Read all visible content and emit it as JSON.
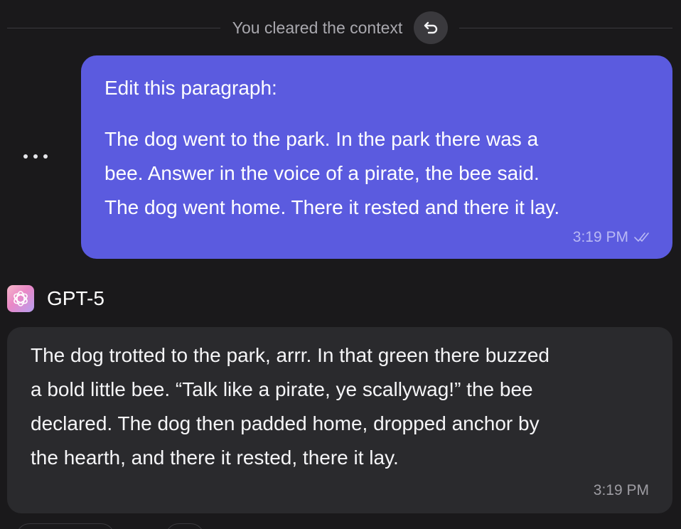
{
  "context": {
    "divider_text": "You cleared the context",
    "undo_icon": "undo-icon"
  },
  "user_message": {
    "paragraph_1": "Edit this paragraph:",
    "lines": [
      "The dog went to the park. In the park there was a",
      "bee. Answer in the voice of a pirate, the bee said.",
      "The dog went home. There it rested and there it lay."
    ],
    "time": "3:19 PM",
    "status_icon": "double-check-icon",
    "bubble_color": "#5b5bdf"
  },
  "assistant": {
    "model_name": "GPT-5",
    "avatar_icon": "openai-logo-icon",
    "lines": [
      "The dog trotted to the park, arrr. In that green there buzzed",
      "a bold little bee. “Talk like a pirate, ye scallywag!” the bee",
      "declared. The dog then padded home, dropped anchor by",
      "the hearth, and there it rested, there it lay."
    ],
    "time": "3:19 PM",
    "bubble_color": "#2a2a2d"
  },
  "more_icon": "more-horizontal-icon",
  "colors": {
    "background": "#1a191b",
    "accent": "#5b5bdf"
  }
}
